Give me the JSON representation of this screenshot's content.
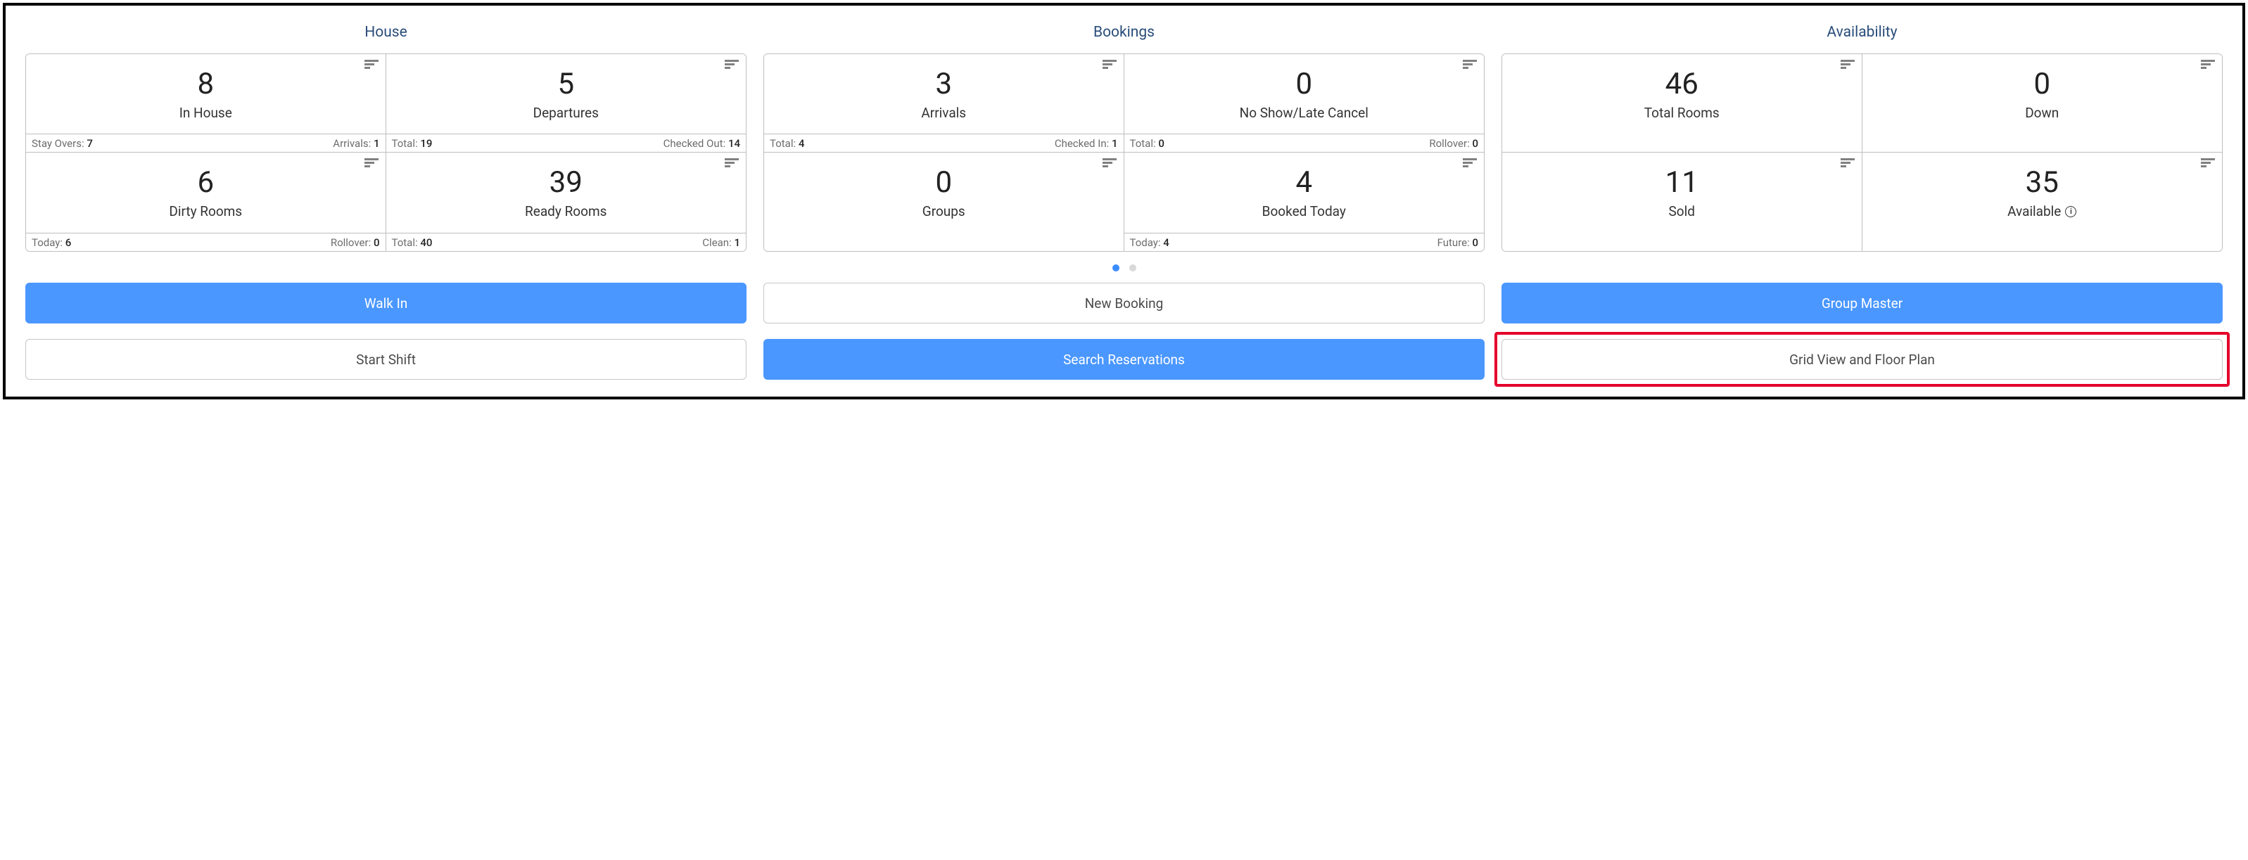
{
  "sections": {
    "house": {
      "title": "House",
      "cards": [
        {
          "value": "8",
          "label": "In House",
          "leftKey": "Stay Overs:",
          "leftVal": "7",
          "rightKey": "Arrivals:",
          "rightVal": "1"
        },
        {
          "value": "5",
          "label": "Departures",
          "leftKey": "Total:",
          "leftVal": "19",
          "rightKey": "Checked Out:",
          "rightVal": "14"
        },
        {
          "value": "6",
          "label": "Dirty Rooms",
          "leftKey": "Today:",
          "leftVal": "6",
          "rightKey": "Rollover:",
          "rightVal": "0"
        },
        {
          "value": "39",
          "label": "Ready Rooms",
          "leftKey": "Total:",
          "leftVal": "40",
          "rightKey": "Clean:",
          "rightVal": "1"
        }
      ]
    },
    "bookings": {
      "title": "Bookings",
      "cards": [
        {
          "value": "3",
          "label": "Arrivals",
          "leftKey": "Total:",
          "leftVal": "4",
          "rightKey": "Checked In:",
          "rightVal": "1"
        },
        {
          "value": "0",
          "label": "No Show/Late Cancel",
          "leftKey": "Total:",
          "leftVal": "0",
          "rightKey": "Rollover:",
          "rightVal": "0"
        },
        {
          "value": "0",
          "label": "Groups",
          "leftKey": "",
          "leftVal": "",
          "rightKey": "",
          "rightVal": ""
        },
        {
          "value": "4",
          "label": "Booked Today",
          "leftKey": "Today:",
          "leftVal": "4",
          "rightKey": "Future:",
          "rightVal": "0"
        }
      ]
    },
    "availability": {
      "title": "Availability",
      "cards": [
        {
          "value": "46",
          "label": "Total Rooms"
        },
        {
          "value": "0",
          "label": "Down"
        },
        {
          "value": "11",
          "label": "Sold"
        },
        {
          "value": "35",
          "label": "Available",
          "info": true
        }
      ]
    }
  },
  "buttons": {
    "walk_in": "Walk In",
    "new_booking": "New Booking",
    "group_master": "Group Master",
    "start_shift": "Start Shift",
    "search_reservations": "Search Reservations",
    "grid_view": "Grid View and Floor Plan"
  },
  "info_glyph": "i"
}
